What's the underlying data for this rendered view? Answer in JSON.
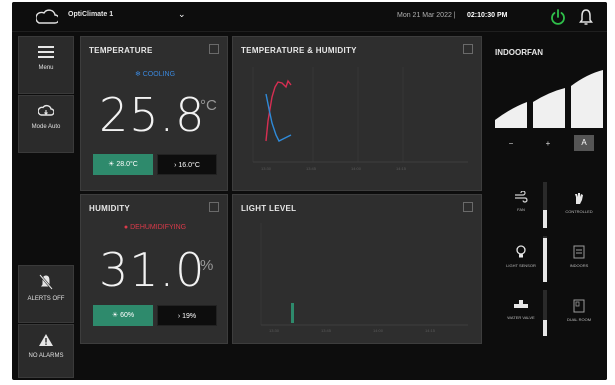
{
  "header": {
    "device_name": "OptiClimate 1",
    "date": "Mon 21 Mar 2022 |",
    "time": "02:10:30 PM"
  },
  "sidebar": {
    "menu_label": "Menu",
    "mode_label": "Mode Auto",
    "alerts_label": "ALERTS OFF",
    "alarms_label": "NO ALARMS"
  },
  "temperature": {
    "title": "TEMPERATURE",
    "status": "COOLING",
    "value": "25.8",
    "unit": "°C",
    "heat_setpoint": "28.0°C",
    "cool_setpoint": "16.0°C"
  },
  "humidity": {
    "title": "HUMIDITY",
    "status": "DEHUMIDIFYING",
    "value": "31.0",
    "unit": "%",
    "low_setpoint": "60%",
    "high_setpoint": "19%"
  },
  "temp_humidity_chart": {
    "title": "TEMPERATURE & HUMIDITY",
    "x_ticks": [
      "13:30",
      "13:45",
      "14:00",
      "14:15"
    ]
  },
  "light_chart": {
    "title": "LIGHT LEVEL",
    "x_ticks": [
      "13:30",
      "13:45",
      "14:00",
      "14:15"
    ]
  },
  "indoor_fan": {
    "title": "INDOORFAN",
    "minus_label": "−",
    "plus_label": "+",
    "auto_label": "A",
    "speed_level": 3
  },
  "controls": {
    "fan_label": "FAN",
    "controlled_label": "CONTROLLED",
    "light_sensor_label": "LIGHT SENSOR",
    "water_valve_label": "WATER VALVE",
    "dual_room_label": "DUAL ROOM",
    "sensor2_label": "INDOORS"
  },
  "colors": {
    "cooling": "#3a86d9",
    "dehumidifying": "#d93a4a",
    "heat_chip": "#2e8a6c",
    "humidity_line": "#2f8ad8",
    "temperature_line": "#d62e52",
    "light_bar": "#2e8a6c"
  }
}
